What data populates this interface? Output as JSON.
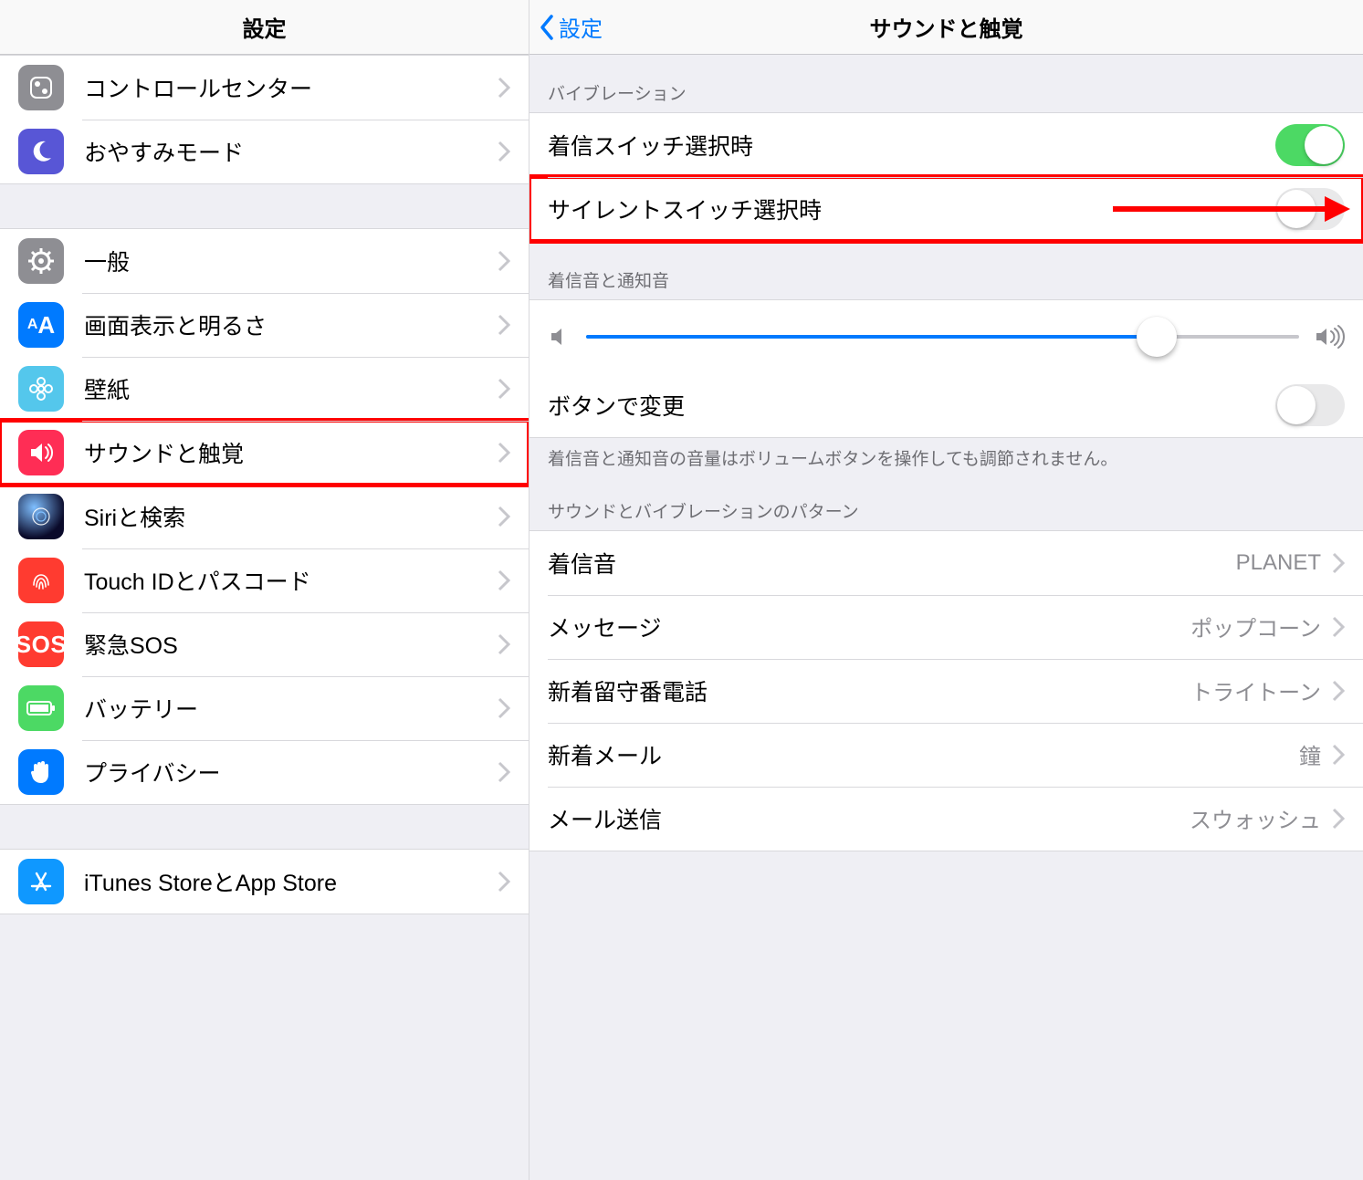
{
  "left": {
    "title": "設定",
    "groups": [
      {
        "items": [
          {
            "id": "control-center",
            "label": "コントロールセンター",
            "icon": "control"
          },
          {
            "id": "dnd",
            "label": "おやすみモード",
            "icon": "dnd"
          }
        ]
      },
      {
        "items": [
          {
            "id": "general",
            "label": "一般",
            "icon": "general"
          },
          {
            "id": "display",
            "label": "画面表示と明るさ",
            "icon": "display"
          },
          {
            "id": "wallpaper",
            "label": "壁紙",
            "icon": "wall"
          },
          {
            "id": "sounds",
            "label": "サウンドと触覚",
            "icon": "sound",
            "highlighted": true
          },
          {
            "id": "siri",
            "label": "Siriと検索",
            "icon": "siri"
          },
          {
            "id": "touchid",
            "label": "Touch IDとパスコード",
            "icon": "touchid"
          },
          {
            "id": "sos",
            "label": "緊急SOS",
            "icon": "sos"
          },
          {
            "id": "battery",
            "label": "バッテリー",
            "icon": "battery"
          },
          {
            "id": "privacy",
            "label": "プライバシー",
            "icon": "privacy"
          }
        ]
      },
      {
        "items": [
          {
            "id": "itunes-appstore",
            "label": "iTunes StoreとApp Store",
            "icon": "itunes"
          }
        ]
      }
    ]
  },
  "right": {
    "title": "サウンドと触覚",
    "back_label": "設定",
    "sections": {
      "vibration": {
        "header": "バイブレーション",
        "ring_switch": {
          "label": "着信スイッチ選択時",
          "on": true
        },
        "silent_switch": {
          "label": "サイレントスイッチ選択時",
          "on": false,
          "highlighted": true
        }
      },
      "ringer": {
        "header": "着信音と通知音",
        "volume_percent": 80,
        "change_with_buttons": {
          "label": "ボタンで変更",
          "on": false
        },
        "footer": "着信音と通知音の音量はボリュームボタンを操作しても調節されません。"
      },
      "patterns": {
        "header": "サウンドとバイブレーションのパターン",
        "items": [
          {
            "id": "ringtone",
            "label": "着信音",
            "value": "PLANET"
          },
          {
            "id": "text-tone",
            "label": "メッセージ",
            "value": "ポップコーン"
          },
          {
            "id": "new-voicemail",
            "label": "新着留守番電話",
            "value": "トライトーン"
          },
          {
            "id": "new-mail",
            "label": "新着メール",
            "value": "鐘"
          },
          {
            "id": "sent-mail",
            "label": "メール送信",
            "value": "スウォッシュ"
          }
        ]
      }
    }
  }
}
